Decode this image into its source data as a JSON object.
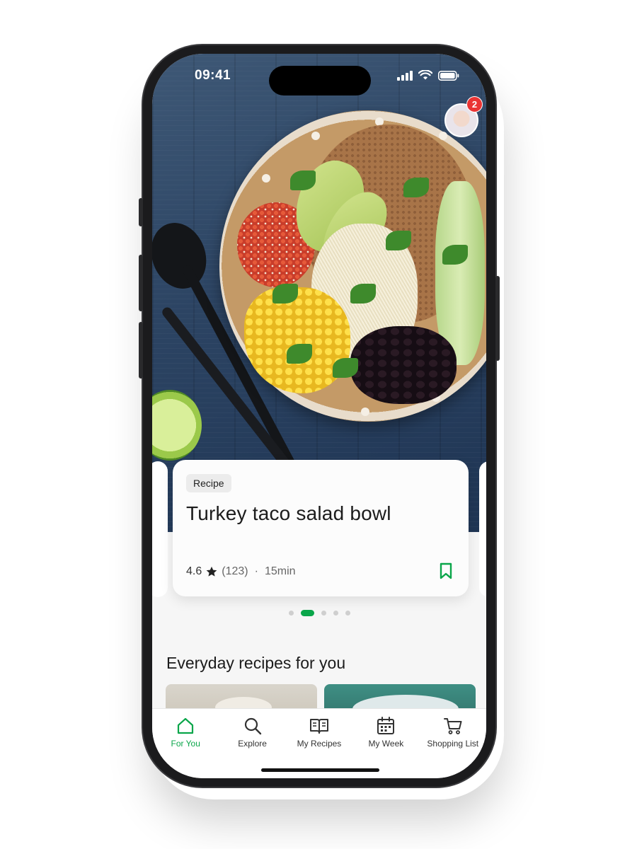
{
  "status": {
    "time": "09:41"
  },
  "profile": {
    "notification_count": "2"
  },
  "featured": {
    "tag": "Recipe",
    "title": "Turkey taco salad bowl",
    "rating": "4.6",
    "reviews": "(123)",
    "separator": "·",
    "duration": "15min",
    "carousel_pages": 5,
    "carousel_active": 2
  },
  "section": {
    "title": "Everyday recipes for you"
  },
  "nav": {
    "items": [
      {
        "label": "For You",
        "icon": "home-icon",
        "active": true
      },
      {
        "label": "Explore",
        "icon": "search-icon",
        "active": false
      },
      {
        "label": "My Recipes",
        "icon": "book-icon",
        "active": false
      },
      {
        "label": "My Week",
        "icon": "calendar-icon",
        "active": false
      },
      {
        "label": "Shopping List",
        "icon": "cart-icon",
        "active": false
      }
    ]
  },
  "colors": {
    "accent": "#0aa64a",
    "badge": "#ea3434"
  }
}
